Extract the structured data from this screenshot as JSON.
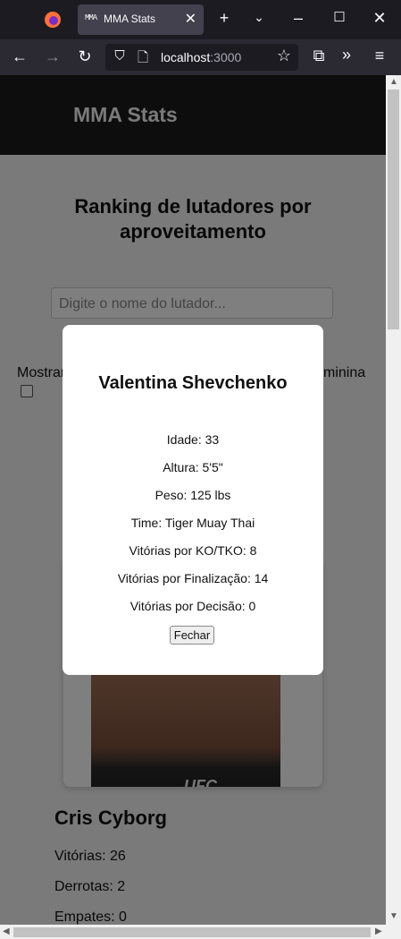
{
  "browser": {
    "tab_title": "MMA Stats",
    "tab_favicon_text": "MMA",
    "url_host": "localhost",
    "url_port": ":3000",
    "icons": [
      "firefox-icon",
      "close-icon",
      "plus-icon",
      "chevron-down-icon",
      "minimize-icon",
      "maximize-icon",
      "window-close-icon",
      "back-icon",
      "forward-icon",
      "reload-icon",
      "shield-icon",
      "page-icon",
      "star-icon",
      "extensions-icon",
      "overflow-icon",
      "menu-icon"
    ]
  },
  "header": {
    "brand": "MMA Stats"
  },
  "main": {
    "heading": "Ranking de lutadores por aproveitamento",
    "search_placeholder": "Digite o nome do lutador...",
    "filter_left_fragment": "Mostrar",
    "filter_right_fragment": "minina"
  },
  "card": {
    "logo_text": "UFC",
    "fighter_name": "Cris Cyborg",
    "wins": "Vitórias: 26",
    "losses": "Derrotas: 2",
    "draws": "Empates: 0"
  },
  "modal": {
    "name": "Valentina Shevchenko",
    "age": "Idade: 33",
    "height": "Altura: 5'5\"",
    "weight": "Peso: 125 lbs",
    "team": "Time: Tiger Muay Thai",
    "ko_wins": "Vitórias por KO/TKO: 8",
    "sub_wins": "Vitórias por Finalização: 14",
    "dec_wins": "Vitórias por Decisão: 0",
    "close_label": "Fechar"
  },
  "colors": {
    "header_bg": "#1b1b1b",
    "overlay": "rgba(0,0,0,0.5)",
    "chrome_bg": "#1c1b22"
  }
}
